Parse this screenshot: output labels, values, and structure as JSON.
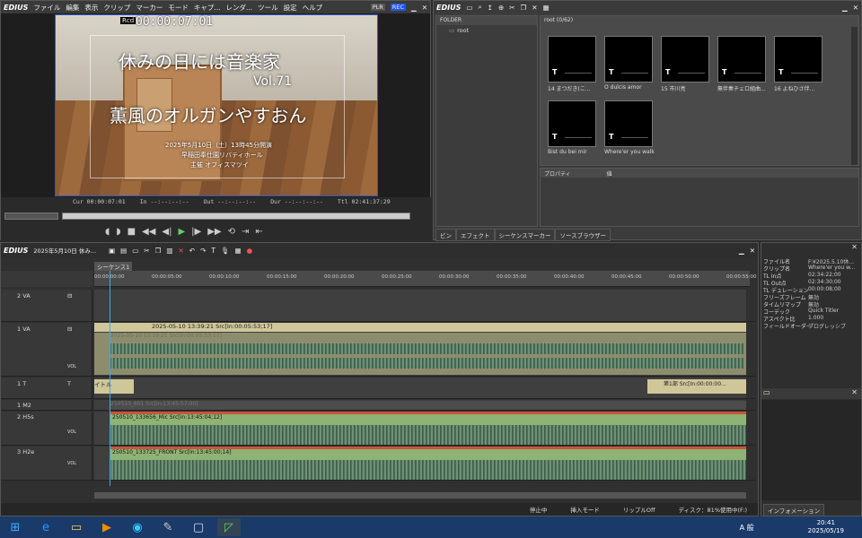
{
  "player": {
    "logo": "EDIUS",
    "menu": [
      "ファイル",
      "編集",
      "表示",
      "クリップ",
      "マーカー",
      "モード",
      "キャプ...",
      "レンダ...",
      "ツール",
      "設定",
      "ヘルプ"
    ],
    "plr": "PLR",
    "rec": "REC",
    "rcd": "Rcd",
    "timecode": "00:00:07:01",
    "title1": "休みの日には音楽家",
    "vol": "Vol.71",
    "title2": "薫風のオルガンやすおん",
    "line1": "2025年5月10日（土）13時45分開演",
    "line2": "早稲田奉仕園リバティホール",
    "line3": "主催 オフィスマツイ",
    "cur": "Cur 00:00:07:01",
    "in": "In --:--:--:--",
    "out": "Out --:--:--:--",
    "dur": "Dur --:--:--:--",
    "ttl": "Ttl 02:41:37:29"
  },
  "bin": {
    "logo": "EDIUS",
    "folder_header": "FOLDER",
    "folder_root": "root",
    "root_header": "root (0/62)",
    "clips": [
      {
        "label": "14 まつだき(こ..."
      },
      {
        "label": "O dulcis amor"
      },
      {
        "label": "15 市川亮"
      },
      {
        "label": "無伴奏チェロ組曲..."
      },
      {
        "label": "16 よねひさ伴..."
      },
      {
        "label": "Bist du bei mir"
      },
      {
        "label": "Where'er you walk"
      }
    ],
    "prop_label": "プロパティ",
    "prop_value": "値",
    "tabs": [
      "ビン",
      "エフェクト",
      "シーケンスマーカー",
      "ソースブラウザー"
    ]
  },
  "timeline": {
    "logo": "EDIUS",
    "project": "2025年5月10日 休み...",
    "sequence_tab": "シーケンス1",
    "ruler": [
      "00:00:00:00",
      "00:00:05:00",
      "00:00:10:00",
      "00:00:15:00",
      "00:00:20:00",
      "00:00:25:00",
      "00:00:30:00",
      "00:00:35:00",
      "00:00:40:00",
      "00:00:45:00",
      "00:00:50:00",
      "00:00:55:00"
    ],
    "tracks": [
      {
        "name": "2 VA"
      },
      {
        "name": "1 VA",
        "clip": "2025-05-10 13:39:21  Src[In:00:05:53;17]",
        "clip2": "2025-05-10 13:39:21  Src[In:00:05:53;17]"
      },
      {
        "name": "1 T",
        "clip": "イトル",
        "clip2": "第1部  Src[In:00:00:00..."
      },
      {
        "name": "1 M2",
        "clip": "250510_601  Src[In:13:45:57;00]"
      },
      {
        "name": "2 H5s",
        "clip": "250510_133656_Mic  Src[In:13:45:04;12]"
      },
      {
        "name": "3 H2e",
        "clip": "250510_133725_FRONT  Src[In:13:45:00;14]"
      }
    ],
    "status": [
      "停止中",
      "挿入モード",
      "リップルOff",
      "ディスク：81%使用中(F:)"
    ]
  },
  "info": {
    "rows": [
      {
        "k": "ファイル名",
        "v": "F:¥2025.5.10休..."
      },
      {
        "k": "クリップ名",
        "v": "Where'er you w..."
      },
      {
        "k": "TL In点",
        "v": "02:34:22;00"
      },
      {
        "k": "TL Out点",
        "v": "02:34:30;00"
      },
      {
        "k": "TL デュレーション",
        "v": "00:00:08;00"
      },
      {
        "k": "フリーズフレーム",
        "v": "無効"
      },
      {
        "k": "タイムリマップ",
        "v": "無効"
      },
      {
        "k": "コーデック",
        "v": "Quick Titler"
      },
      {
        "k": "アスペクト比",
        "v": "1.000"
      },
      {
        "k": "フィールドオーダー",
        "v": "プログレッシブ"
      }
    ],
    "tab": "インフォメーション"
  },
  "taskbar": {
    "ime": "A 般",
    "time": "20:41",
    "date": "2025/05/19"
  },
  "colors": {
    "rec": "#2255ee",
    "track_audio": "#8fb374",
    "track_video": "#cfc79a",
    "tc_bar": "#111"
  }
}
